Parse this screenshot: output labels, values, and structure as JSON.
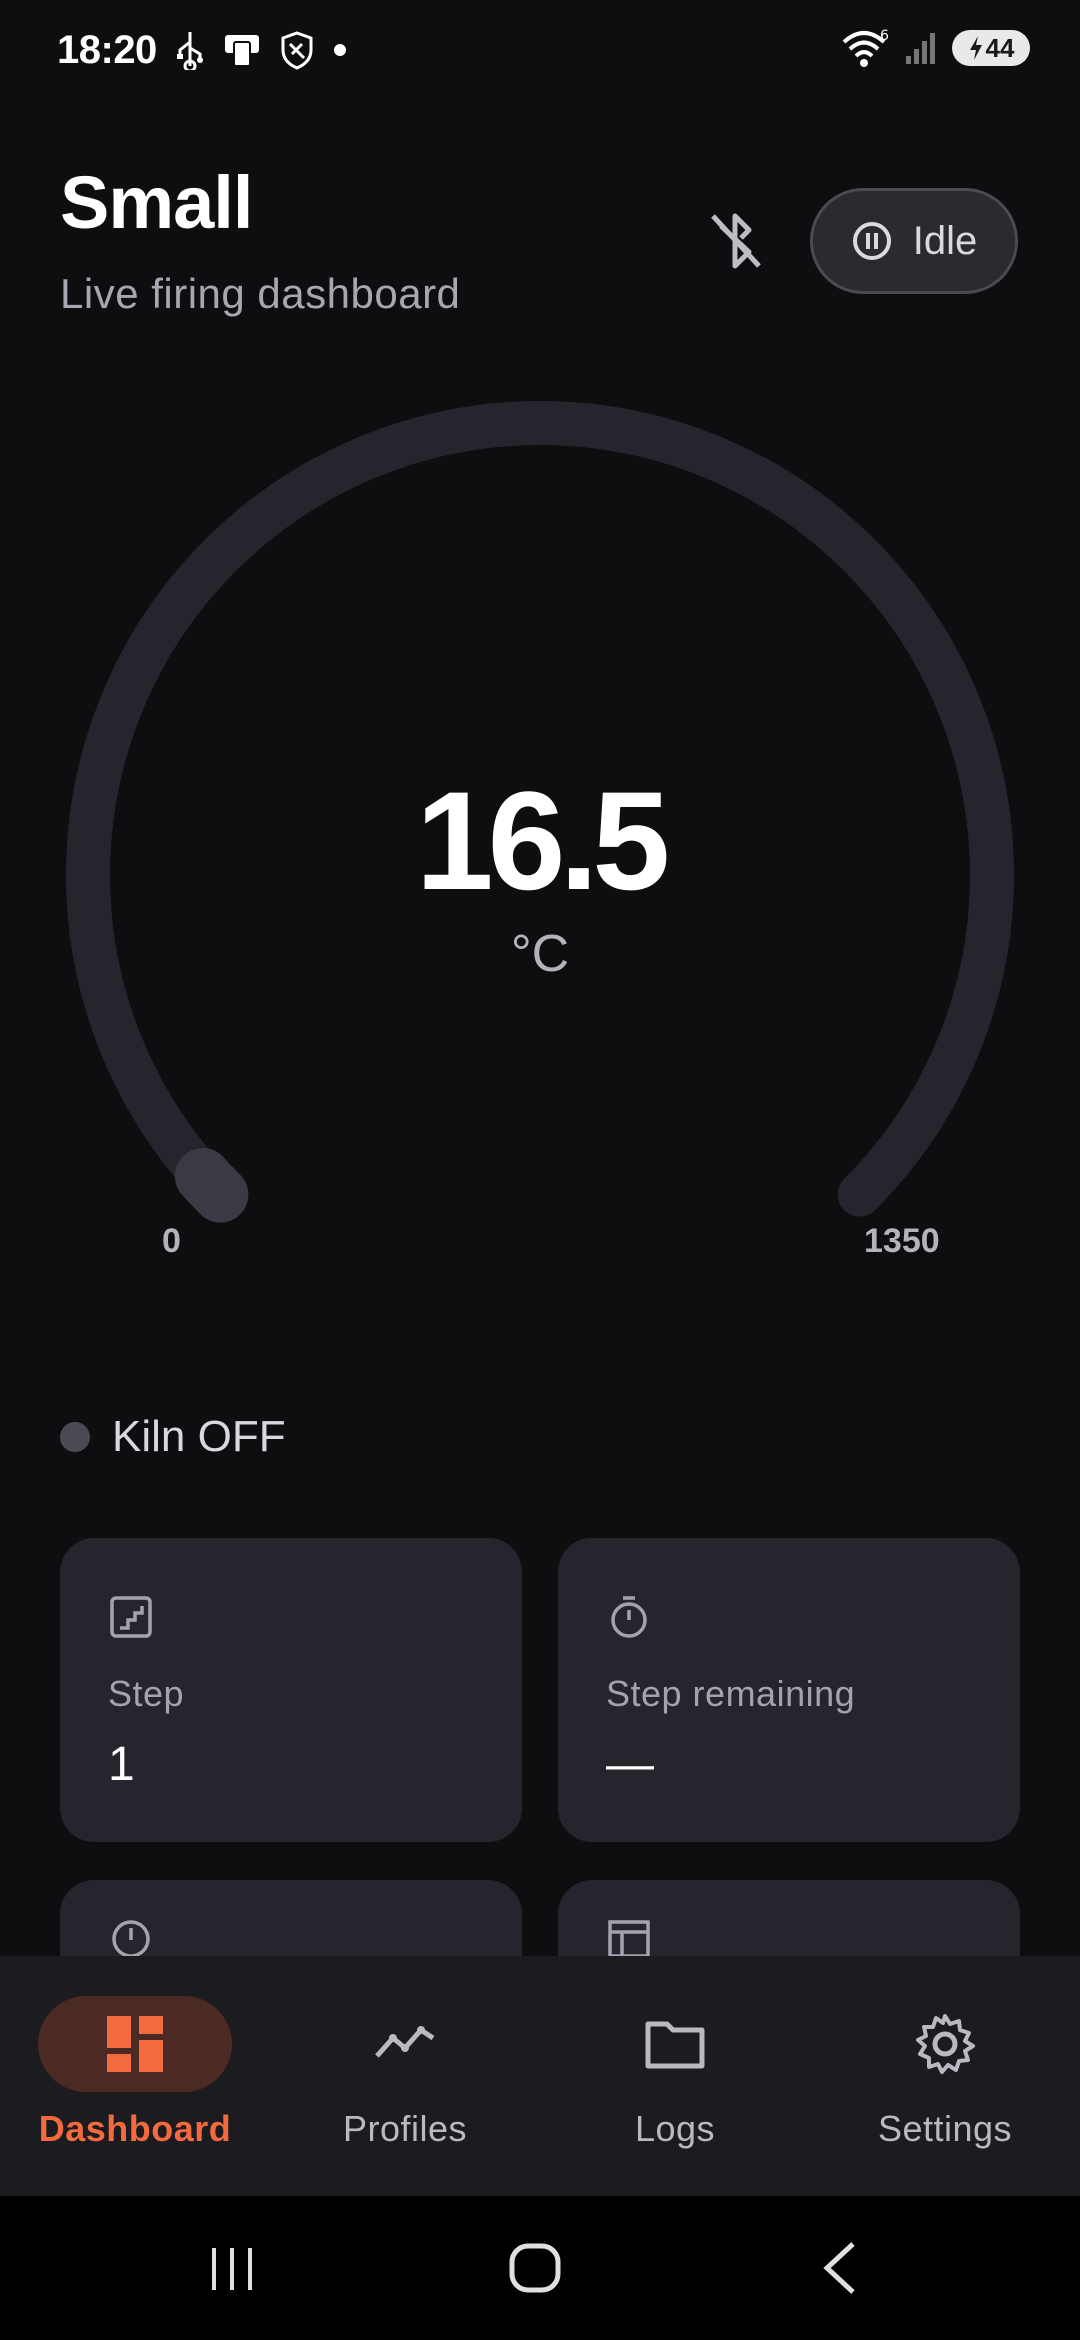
{
  "status_bar": {
    "time": "18:20",
    "left_icons": [
      "usb-icon",
      "phone-card-icon",
      "shield-icon",
      "notification-dot-icon"
    ],
    "right_icons": [
      "wifi-6-icon",
      "signal-icon",
      "battery-charging-icon"
    ],
    "wifi_badge": "6",
    "battery_level": "44"
  },
  "header": {
    "title": "Small",
    "subtitle": "Live firing dashboard",
    "bluetooth_icon": "bluetooth-disabled-icon",
    "status_pill": {
      "icon": "pause-circle-icon",
      "label": "Idle"
    }
  },
  "gauge": {
    "value": "16.5",
    "unit": "°C",
    "min": "0",
    "max": "1350",
    "level_fraction": 0.012
  },
  "kiln_status": {
    "label": "Kiln OFF",
    "color": "#4a4a52"
  },
  "cards": [
    {
      "icon": "step-chart-icon",
      "label": "Step",
      "value": "1"
    },
    {
      "icon": "timer-icon",
      "label": "Step remaining",
      "value": "—"
    },
    {
      "icon": "clock-icon",
      "label": "",
      "value": ""
    },
    {
      "icon": "table-icon",
      "label": "",
      "value": ""
    }
  ],
  "bottom_nav": [
    {
      "label": "Dashboard",
      "icon": "dashboard-icon",
      "active": true
    },
    {
      "label": "Profiles",
      "icon": "chart-line-icon",
      "active": false
    },
    {
      "label": "Logs",
      "icon": "folder-icon",
      "active": false
    },
    {
      "label": "Settings",
      "icon": "gear-icon",
      "active": false
    }
  ],
  "colors": {
    "background": "#0e0e10",
    "card": "#25252e",
    "accent": "#f26a3d",
    "accent_pill": "#4a2a23",
    "gauge_track": "#25252e"
  },
  "system_nav": [
    "recents-icon",
    "home-icon",
    "back-icon"
  ]
}
